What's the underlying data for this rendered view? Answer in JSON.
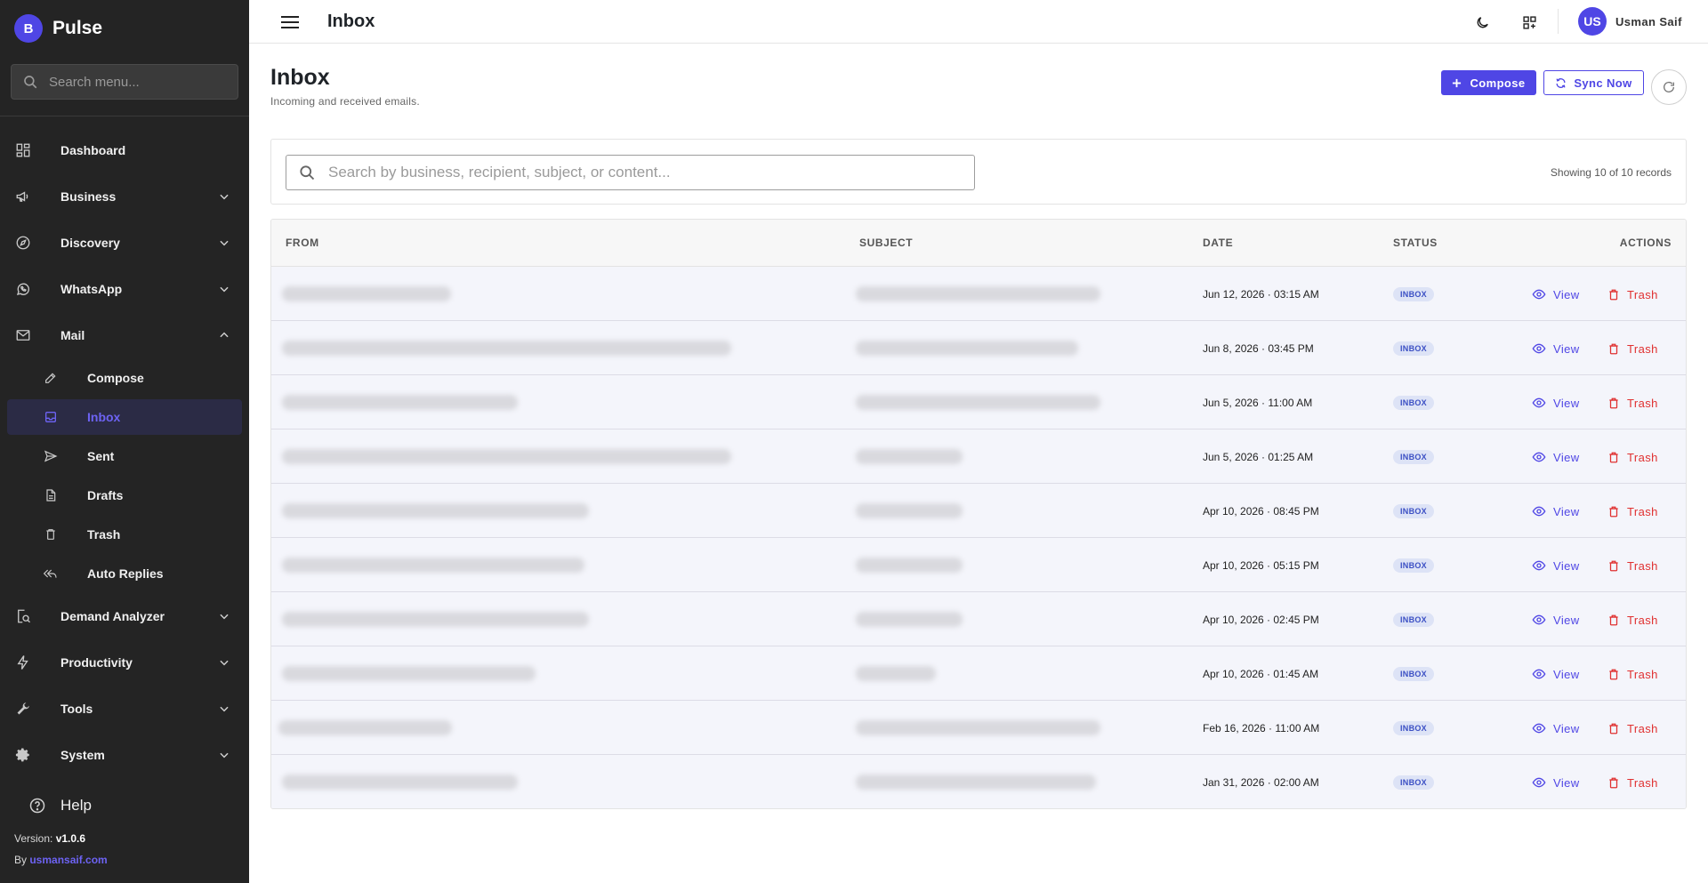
{
  "brand": {
    "initial": "B",
    "name": "Pulse"
  },
  "sidebar": {
    "search_placeholder": "Search menu...",
    "items": [
      {
        "label": "Dashboard",
        "icon": "dashboard-icon"
      },
      {
        "label": "Business",
        "icon": "megaphone-icon"
      },
      {
        "label": "Discovery",
        "icon": "compass-icon"
      },
      {
        "label": "WhatsApp",
        "icon": "whatsapp-icon"
      },
      {
        "label": "Mail",
        "icon": "mail-icon"
      },
      {
        "label": "Demand Analyzer",
        "icon": "search-document-icon"
      },
      {
        "label": "Productivity",
        "icon": "lightning-icon"
      },
      {
        "label": "Tools",
        "icon": "wrench-icon"
      },
      {
        "label": "System",
        "icon": "gear-icon"
      }
    ],
    "mail_sub": [
      {
        "label": "Compose",
        "icon": "pencil-icon"
      },
      {
        "label": "Inbox",
        "icon": "inbox-icon"
      },
      {
        "label": "Sent",
        "icon": "send-icon"
      },
      {
        "label": "Drafts",
        "icon": "document-icon"
      },
      {
        "label": "Trash",
        "icon": "trash-icon"
      },
      {
        "label": "Auto Replies",
        "icon": "reply-all-icon"
      }
    ],
    "help": "Help",
    "version_label": "Version: ",
    "version": "v1.0.6",
    "by_label": "By ",
    "by_link": "usmansaif.com"
  },
  "topbar": {
    "title": "Inbox",
    "user_initials": "US",
    "user_name": "Usman Saif"
  },
  "page": {
    "title": "Inbox",
    "subtitle": "Incoming and received emails.",
    "compose_label": "Compose",
    "sync_label": "Sync Now",
    "search_placeholder": "Search by business, recipient, subject, or content...",
    "showing": "Showing 10 of 10 records"
  },
  "table": {
    "headers": {
      "from": "FROM",
      "subject": "SUBJECT",
      "date": "DATE",
      "status": "STATUS",
      "actions": "ACTIONS"
    },
    "rows": [
      {
        "date": "Jun 12, 2026 · 03:15 AM",
        "status": "INBOX"
      },
      {
        "date": "Jun 8, 2026 · 03:45 PM",
        "status": "INBOX"
      },
      {
        "date": "Jun 5, 2026 · 11:00 AM",
        "status": "INBOX"
      },
      {
        "date": "Jun 5, 2026 · 01:25 AM",
        "status": "INBOX"
      },
      {
        "date": "Apr 10, 2026 · 08:45 PM",
        "status": "INBOX"
      },
      {
        "date": "Apr 10, 2026 · 05:15 PM",
        "status": "INBOX"
      },
      {
        "date": "Apr 10, 2026 · 02:45 PM",
        "status": "INBOX"
      },
      {
        "date": "Apr 10, 2026 · 01:45 AM",
        "status": "INBOX"
      },
      {
        "date": "Feb 16, 2026 · 11:00 AM",
        "status": "INBOX"
      },
      {
        "date": "Jan 31, 2026 · 02:00 AM",
        "status": "INBOX"
      }
    ],
    "view_label": "View",
    "trash_label": "Trash"
  },
  "colors": {
    "accent": "#4f46e5",
    "danger": "#e03131",
    "sidebar_bg": "#242424"
  }
}
